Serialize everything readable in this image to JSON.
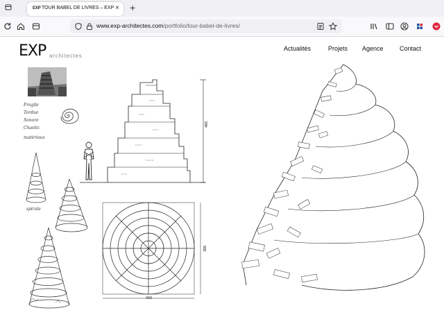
{
  "browser": {
    "tab": {
      "favicon_text": "EXP",
      "title": "TOUR BABEL DE LIVRES – EXP :",
      "close_icon": "close-icon"
    },
    "new_tab_icon": "plus-icon",
    "url_host": "www.exp-architectes.com",
    "url_path": "/portfolio/tour-babel-de-livres/",
    "icons": [
      "back-icon",
      "home-icon",
      "tab-icon",
      "lock-icon",
      "reader-view-icon",
      "star-icon",
      "library-icon",
      "sidebar-icon",
      "account-icon",
      "extension-icon",
      "pocket-icon"
    ]
  },
  "site": {
    "logo_mark": "EXP",
    "logo_sub": "architectes",
    "nav": {
      "actualites": "Actualités",
      "projets": "Projets",
      "agence": "Agence",
      "contact": "Contact"
    }
  },
  "drawings": {
    "sketch_notes": [
      "Fragile",
      "Tordue",
      "Sonore",
      "Chaotic",
      "matériaux",
      "spirale"
    ],
    "dim_height": "460",
    "dim_plan_width": "400",
    "dim_plan_height": "386"
  },
  "colors": {
    "ink": "#222222",
    "toolbar": "#f9f9fb",
    "tabstrip": "#f0f0f4",
    "pocket_red": "#e0253c",
    "extension_blue": "#1a4fa0"
  }
}
